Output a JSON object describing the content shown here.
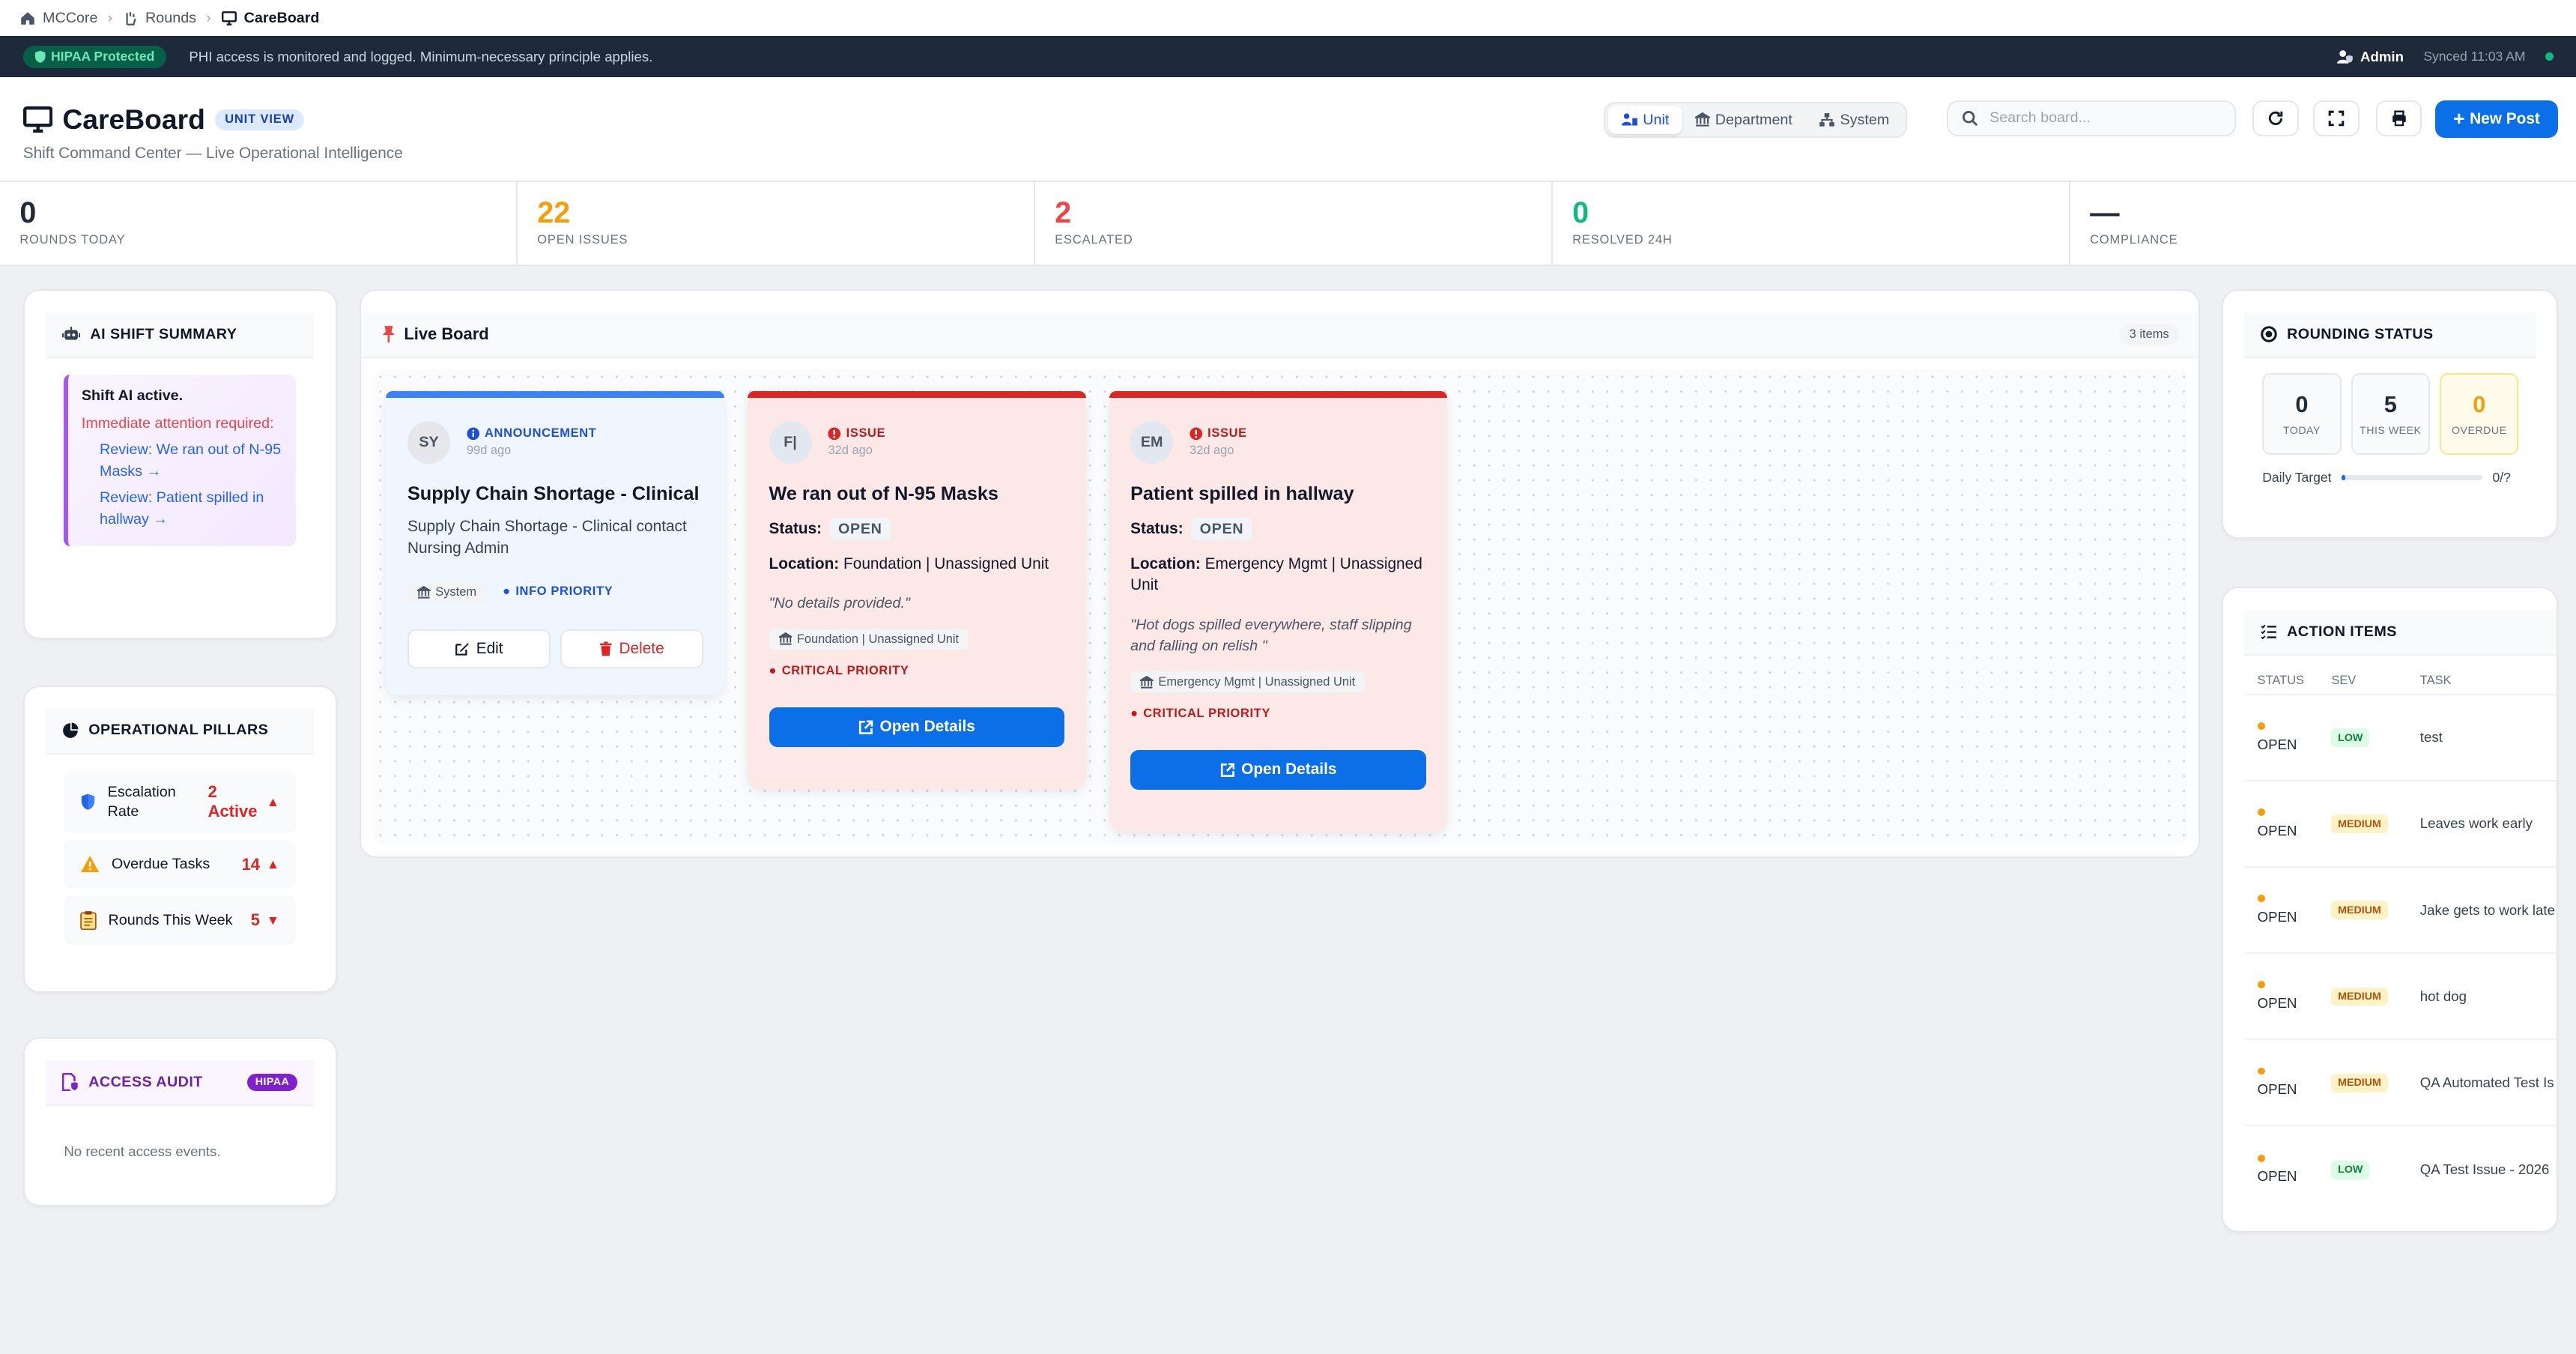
{
  "breadcrumb": [
    "MCCore",
    "Rounds",
    "CareBoard"
  ],
  "hipaa_bar": {
    "badge": "HIPAA Protected",
    "notice": "PHI access is monitored and logged. Minimum-necessary principle applies.",
    "user": "Admin",
    "synced": "Synced 11:03 AM"
  },
  "header": {
    "title": "CareBoard",
    "view_badge": "UNIT VIEW",
    "subtitle": "Shift Command Center — Live Operational Intelligence",
    "scope_tabs": [
      "Unit",
      "Department",
      "System"
    ],
    "search_placeholder": "Search board...",
    "new_post": "New Post"
  },
  "stats": [
    {
      "value": "0",
      "label": "ROUNDS TODAY",
      "color": "#111827"
    },
    {
      "value": "22",
      "label": "OPEN ISSUES",
      "color": "#f59e0b"
    },
    {
      "value": "2",
      "label": "ESCALATED",
      "color": "#ef4444"
    },
    {
      "value": "0",
      "label": "RESOLVED 24H",
      "color": "#10b981"
    },
    {
      "value": "—",
      "label": "COMPLIANCE",
      "color": "#111827"
    }
  ],
  "ai_summary": {
    "title": "AI SHIFT SUMMARY",
    "active": "Shift AI active.",
    "attention": "Immediate attention required:",
    "links": [
      "Review: We ran out of N-95 Masks →",
      "Review: Patient spilled in hallway →"
    ]
  },
  "pillars": {
    "title": "OPERATIONAL PILLARS",
    "items": [
      {
        "label": "Escalation Rate",
        "value": "2 Active",
        "trend": "▲"
      },
      {
        "label": "Overdue Tasks",
        "value": "14",
        "trend": "▲"
      },
      {
        "label": "Rounds This Week",
        "value": "5",
        "trend": "▼"
      }
    ]
  },
  "access_audit": {
    "title": "ACCESS AUDIT",
    "badge": "HIPAA",
    "empty": "No recent access events."
  },
  "live_board": {
    "title": "Live Board",
    "count": "3 items",
    "cards": [
      {
        "initials": "SY",
        "type": "ANNOUNCEMENT",
        "age": "99d ago",
        "title": "Supply Chain Shortage - Clinical",
        "body": "Supply Chain Shortage - Clinical contact Nursing Admin",
        "source": "System",
        "priority": "INFO PRIORITY",
        "edit": "Edit",
        "delete": "Delete"
      },
      {
        "initials": "F|",
        "type": "ISSUE",
        "age": "32d ago",
        "title": "We ran out of N-95 Masks",
        "status_label": "Status:",
        "status": "OPEN",
        "location_label": "Location:",
        "location": "Foundation | Unassigned Unit",
        "quote": "\"No details provided.\"",
        "chip": "Foundation | Unassigned Unit",
        "priority": "CRITICAL PRIORITY",
        "action": "Open Details"
      },
      {
        "initials": "EM",
        "type": "ISSUE",
        "age": "32d ago",
        "title": "Patient spilled in hallway",
        "status_label": "Status:",
        "status": "OPEN",
        "location_label": "Location:",
        "location": "Emergency Mgmt | Unassigned Unit",
        "quote": "\"Hot dogs spilled everywhere, staff slipping and falling on relish \"",
        "chip": "Emergency Mgmt | Unassigned Unit",
        "priority": "CRITICAL PRIORITY",
        "action": "Open Details"
      }
    ]
  },
  "rounding": {
    "title": "ROUNDING STATUS",
    "boxes": [
      {
        "value": "0",
        "label": "TODAY"
      },
      {
        "value": "5",
        "label": "THIS WEEK"
      },
      {
        "value": "0",
        "label": "OVERDUE"
      }
    ],
    "target_label": "Daily Target",
    "target_value": "0/?",
    "progress": 0.03
  },
  "action_items": {
    "title": "ACTION ITEMS",
    "columns": [
      "STATUS",
      "SEV",
      "TASK"
    ],
    "rows": [
      {
        "status": "OPEN",
        "sev": "LOW",
        "task": "test"
      },
      {
        "status": "OPEN",
        "sev": "MEDIUM",
        "task": "Leaves work early"
      },
      {
        "status": "OPEN",
        "sev": "MEDIUM",
        "task": "Jake gets to work late"
      },
      {
        "status": "OPEN",
        "sev": "MEDIUM",
        "task": "hot dog"
      },
      {
        "status": "OPEN",
        "sev": "MEDIUM",
        "task": "QA Automated Test Is"
      },
      {
        "status": "OPEN",
        "sev": "LOW",
        "task": "QA Test Issue - 2026"
      }
    ]
  }
}
